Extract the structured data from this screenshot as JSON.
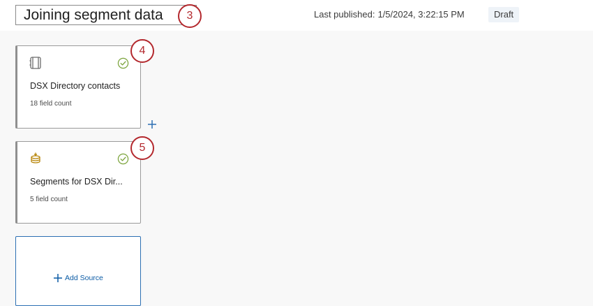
{
  "header": {
    "title": "Joining segment data",
    "last_published_label": "Last published:",
    "last_published_value": "1/5/2024, 3:22:15 PM",
    "status": "Draft"
  },
  "annotations": {
    "title_step": "3",
    "card1_step": "4",
    "card2_step": "5"
  },
  "sources": [
    {
      "name": "DSX Directory contacts",
      "count": "18 field count",
      "icon": "directory-book-icon",
      "status_icon": "check-circle-icon"
    },
    {
      "name": "Segments for DSX Dir...",
      "count": "5 field count",
      "icon": "database-stack-icon",
      "status_icon": "check-circle-icon"
    }
  ],
  "add_source": {
    "label": "Add Source",
    "icon": "plus-icon"
  },
  "colors": {
    "accent_blue": "#0b5ba5",
    "annotation_red": "#b3282d",
    "success_green": "#7aa33a",
    "database_gold": "#b8860b"
  }
}
